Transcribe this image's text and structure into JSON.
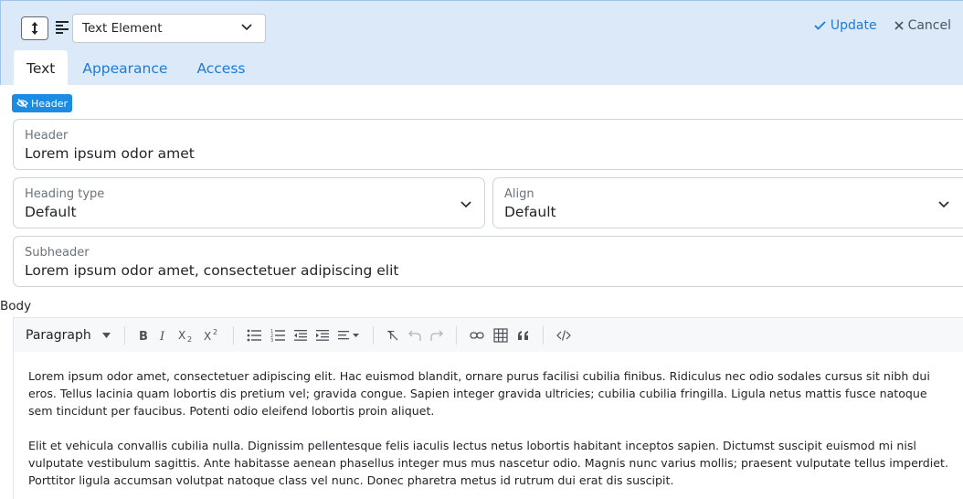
{
  "toolbar": {
    "element_type": "Text Element",
    "update_label": "Update",
    "cancel_label": "Cancel"
  },
  "tabs": [
    {
      "label": "Text",
      "active": true
    },
    {
      "label": "Appearance",
      "active": false
    },
    {
      "label": "Access",
      "active": false
    }
  ],
  "header_badge": "Header",
  "fields": {
    "header": {
      "label": "Header",
      "value": "Lorem ipsum odor amet"
    },
    "heading_type": {
      "label": "Heading type",
      "value": "Default"
    },
    "align": {
      "label": "Align",
      "value": "Default"
    },
    "subheader": {
      "label": "Subheader",
      "value": "Lorem ipsum odor amet, consectetuer adipiscing elit"
    }
  },
  "body": {
    "label": "Body",
    "format_select": "Paragraph",
    "tool_icons": [
      "bold-icon",
      "italic-icon",
      "subscript-icon",
      "superscript-icon",
      "bullet-list-icon",
      "numbered-list-icon",
      "outdent-icon",
      "indent-icon",
      "align-icon",
      "clear-format-icon",
      "undo-icon",
      "redo-icon",
      "link-icon",
      "table-icon",
      "quote-icon",
      "code-icon"
    ],
    "paragraphs": [
      "Lorem ipsum odor amet, consectetuer adipiscing elit. Hac euismod blandit, ornare purus facilisi cubilia finibus. Ridiculus nec odio sodales cursus sit nibh dui eros. Tellus lacinia quam lobortis dis pretium vel; gravida congue. Sapien integer gravida ultricies; cubilia cubilia fringilla. Ligula netus mattis fusce natoque sem tincidunt per faucibus. Potenti odio eleifend lobortis proin aliquet.",
      "Elit et vehicula convallis cubilia nulla. Dignissim pellentesque felis iaculis lectus netus lobortis habitant inceptos sapien. Dictumst suscipit euismod mi nisl vulputate vestibulum sagittis. Ante habitasse aenean phasellus integer mus mus nascetur odio. Magnis nunc varius mollis; praesent vulputate tellus imperdiet. Porttitor ligula accumsan volutpat natoque class vel nunc. Donec pharetra metus id rutrum dui erat dis suscipit."
    ]
  },
  "colors": {
    "accent": "#1f7ad6",
    "topbar_bg": "#dbe9f8",
    "badge_bg": "#1a8ce5"
  }
}
